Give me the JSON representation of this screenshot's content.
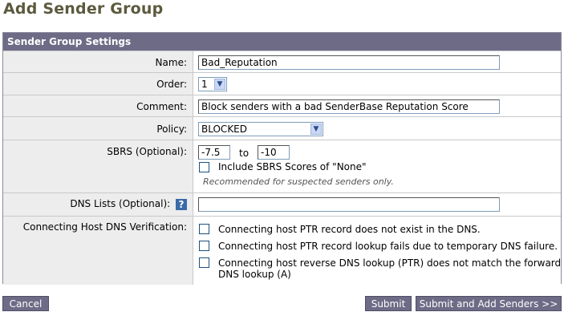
{
  "page": {
    "title": "Add Sender Group"
  },
  "panel": {
    "header": "Sender Group Settings"
  },
  "fields": {
    "name": {
      "label": "Name:",
      "value": "Bad_Reputation"
    },
    "order": {
      "label": "Order:",
      "value": "1"
    },
    "comment": {
      "label": "Comment:",
      "value": "Block senders with a bad SenderBase Reputation Score"
    },
    "policy": {
      "label": "Policy:",
      "value": "BLOCKED"
    },
    "sbrs": {
      "label": "SBRS (Optional):",
      "from": "-7.5",
      "to_label": "to",
      "to": "-10",
      "include_none_label": "Include SBRS Scores of \"None\"",
      "include_none_checked": false,
      "note": "Recommended for suspected senders only."
    },
    "dns_lists": {
      "label": "DNS Lists (Optional):",
      "help": "?",
      "value": ""
    },
    "dns_verification": {
      "label": "Connecting Host DNS Verification:",
      "options": [
        {
          "label": "Connecting host PTR record does not exist in the DNS.",
          "checked": false
        },
        {
          "label": "Connecting host PTR record lookup fails due to temporary DNS failure.",
          "checked": false
        },
        {
          "label_line1": "Connecting host reverse DNS lookup (PTR) does not match the forward",
          "label_line2": "DNS lookup (A)",
          "checked": false
        }
      ]
    }
  },
  "buttons": {
    "cancel": "Cancel",
    "submit": "Submit",
    "submit_add": "Submit and Add Senders >>"
  },
  "colors": {
    "title": "#5c5a3e",
    "header_bg": "#6d6b86",
    "label_bg": "#ededed"
  }
}
